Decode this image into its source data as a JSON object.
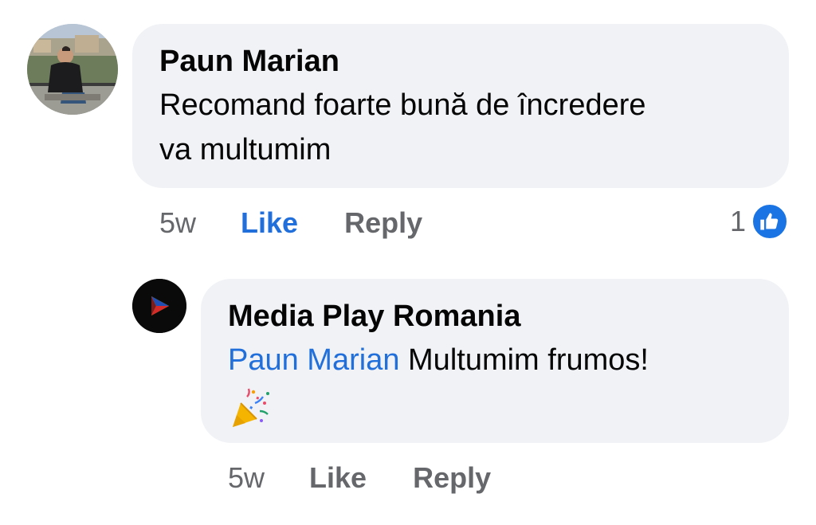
{
  "comment": {
    "author": "Paun Marian",
    "text_line_1": "Recomand foarte bună de încredere",
    "text_line_2": "va multumim",
    "time": "5w",
    "like_label": "Like",
    "reply_label": "Reply",
    "reaction_count": "1",
    "reaction_icon": "thumbs-up-icon",
    "like_active": true
  },
  "reply": {
    "author": "Media Play Romania",
    "mention": "Paun Marian",
    "text": "Multumim frumos!",
    "emoji": "party-popper-icon",
    "time": "5w",
    "like_label": "Like",
    "reply_label": "Reply"
  },
  "colors": {
    "bubble_bg": "#f0f2f5",
    "link_blue": "#216fdb",
    "muted_text": "#65676b",
    "like_badge": "#1b74e4"
  }
}
